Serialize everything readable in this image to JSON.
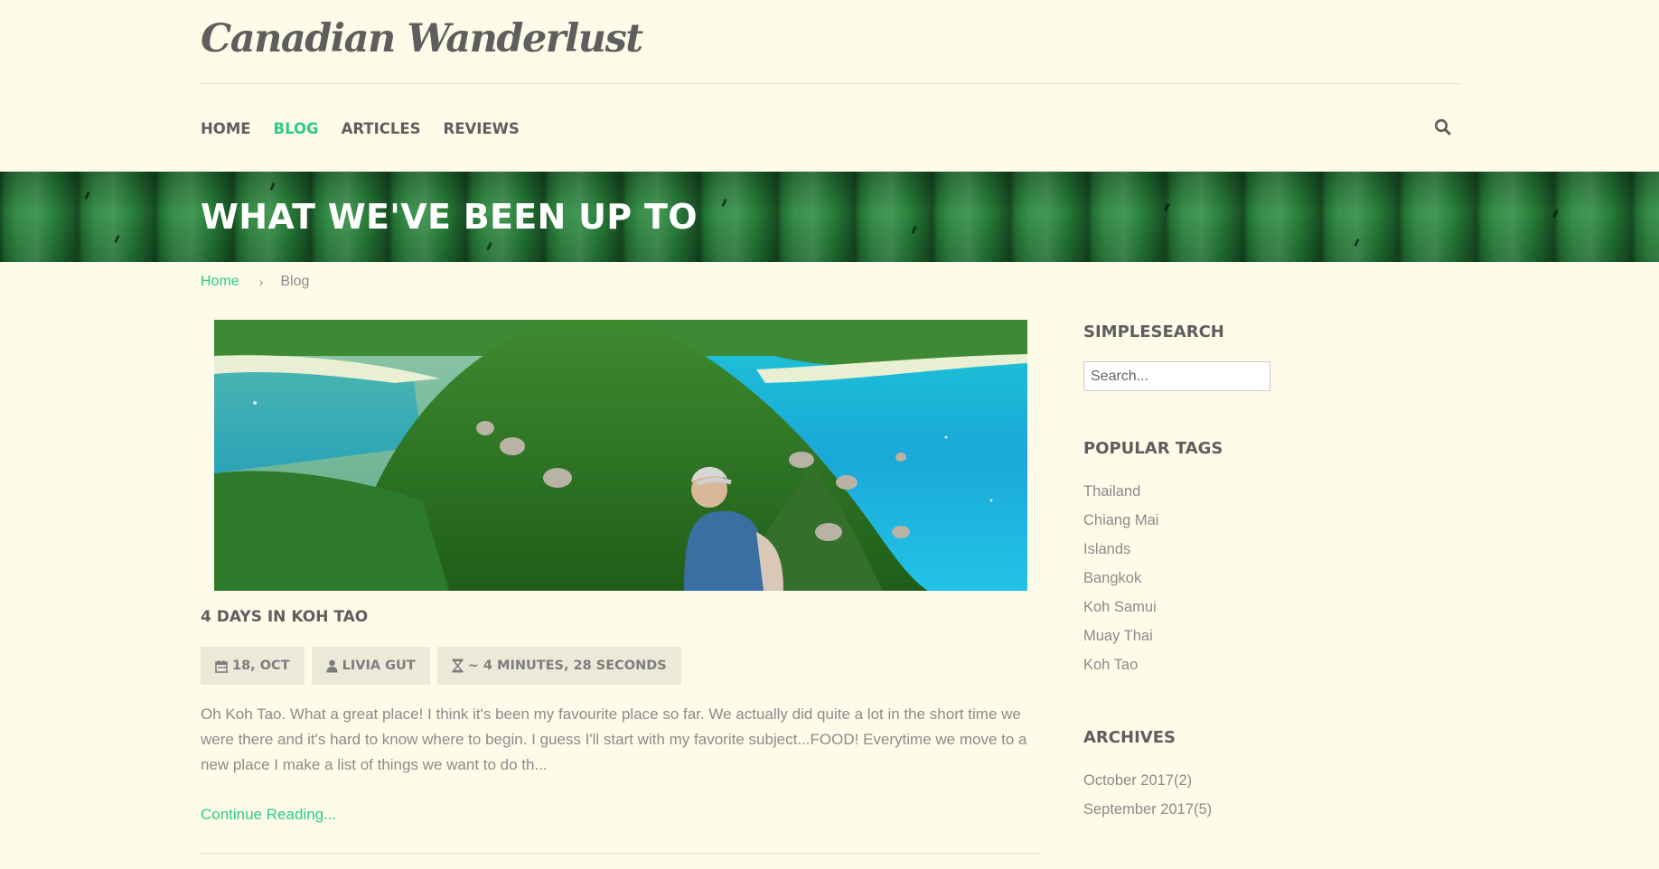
{
  "header": {
    "site_title": "Canadian Wanderlust"
  },
  "nav": {
    "items": [
      {
        "label": "HOME"
      },
      {
        "label": "BLOG",
        "active": true
      },
      {
        "label": "ARTICLES"
      },
      {
        "label": "REVIEWS"
      }
    ],
    "search_icon": "search-icon"
  },
  "hero": {
    "title": "WHAT WE'VE BEEN UP TO"
  },
  "breadcrumb": {
    "home": "Home",
    "separator": "›",
    "current": "Blog"
  },
  "post": {
    "title": "4 DAYS IN KOH TAO",
    "date": "18, OCT",
    "author": "LIVIA GUT",
    "read_time": "~ 4 MINUTES, 28 SECONDS",
    "excerpt": "Oh Koh Tao. What a great place! I think it's been my favourite place so far. We actually did quite a lot in the short time we were there and it's hard to know where to begin. I guess I'll start with my favorite subject...FOOD! Everytime we move to a new place I make a list of things we want to do th...",
    "read_more": "Continue Reading..."
  },
  "sidebar": {
    "search_heading": "SIMPLESEARCH",
    "search_placeholder": "Search...",
    "tags_heading": "POPULAR TAGS",
    "tags": [
      "Thailand",
      "Chiang Mai",
      "Islands",
      "Bangkok",
      "Koh Samui",
      "Muay Thai",
      "Koh Tao"
    ],
    "archives_heading": "ARCHIVES",
    "archives": [
      "October 2017(2)",
      "September 2017(5)"
    ]
  },
  "colors": {
    "background": "#fefce9",
    "accent": "#2dc98a",
    "heading": "#5e5e5e",
    "text": "#8a8a8a",
    "meta_bg": "#ebe9d8",
    "hero_green": "#1f6b30"
  }
}
